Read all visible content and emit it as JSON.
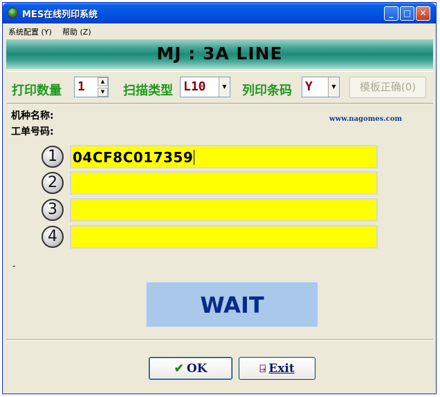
{
  "window": {
    "title": "MES在线列印系统",
    "minimize_icon": "minimize-icon",
    "maximize_icon": "maximize-icon",
    "close_icon": "close-icon"
  },
  "menu": {
    "items": [
      {
        "label": "系统配置 (Y)"
      },
      {
        "label": "帮助 (Z)"
      }
    ]
  },
  "header": {
    "title": "MJ : 3A LINE"
  },
  "controls": {
    "print_qty_label": "打印数量",
    "print_qty_value": "1",
    "scan_type_label": "扫描类型",
    "scan_type_value": "L10",
    "print_barcode_label": "列印条码",
    "print_barcode_value": "Y",
    "template_button": "模板正确(0)"
  },
  "info": {
    "model_name_label": "机种名称:",
    "work_order_label": "工单号码:",
    "website": "www.nagomes.com"
  },
  "barcode_fields": [
    {
      "index": "1",
      "value": "04CF8C017359"
    },
    {
      "index": "2",
      "value": ""
    },
    {
      "index": "3",
      "value": ""
    },
    {
      "index": "4",
      "value": ""
    }
  ],
  "status": {
    "dash": "-",
    "wait_text": "WAIT"
  },
  "buttons": {
    "ok_label": "OK",
    "exit_label": "Exit"
  },
  "colors": {
    "field_bg": "#ffff00",
    "label_green": "#1e9a1e",
    "value_red": "#8b0000",
    "wait_bg": "#a9c8ea",
    "wait_text": "#0a2a8a"
  }
}
